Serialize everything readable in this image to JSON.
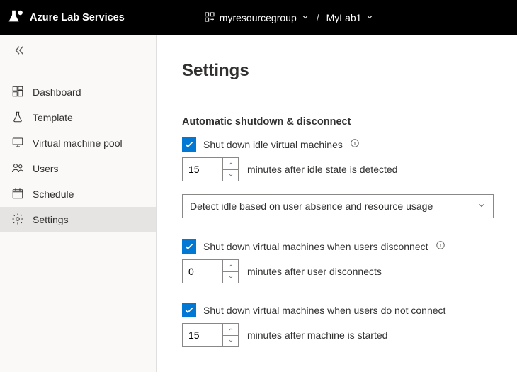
{
  "header": {
    "brand": "Azure Lab Services",
    "resourceGroup": "myresourcegroup",
    "separator": "/",
    "lab": "MyLab1"
  },
  "sidebar": {
    "items": [
      {
        "label": "Dashboard"
      },
      {
        "label": "Template"
      },
      {
        "label": "Virtual machine pool"
      },
      {
        "label": "Users"
      },
      {
        "label": "Schedule"
      },
      {
        "label": "Settings"
      }
    ]
  },
  "page": {
    "title": "Settings",
    "section_title": "Automatic shutdown & disconnect",
    "idle": {
      "checkbox_label": "Shut down idle virtual machines",
      "minutes": "15",
      "hint": "minutes after idle state is detected",
      "dropdown": "Detect idle based on user absence and resource usage"
    },
    "disconnect": {
      "checkbox_label": "Shut down virtual machines when users disconnect",
      "minutes": "0",
      "hint": "minutes after user disconnects"
    },
    "noconnect": {
      "checkbox_label": "Shut down virtual machines when users do not connect",
      "minutes": "15",
      "hint": "minutes after machine is started"
    }
  }
}
